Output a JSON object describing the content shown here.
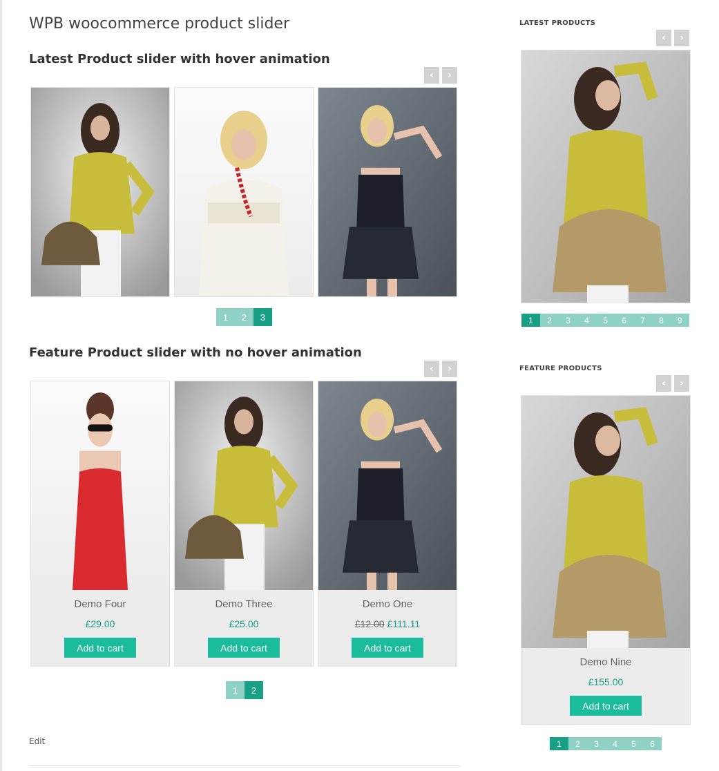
{
  "page": {
    "title": "WPB woocommerce product slider",
    "edit_label": "Edit"
  },
  "nav": {
    "prev": "‹",
    "next": "›"
  },
  "latest_slider": {
    "heading": "Latest Product slider with hover animation",
    "pages": [
      "1",
      "2",
      "3"
    ],
    "active_page": "3"
  },
  "feature_slider": {
    "heading": "Feature Product slider with no hover animation",
    "products": [
      {
        "name": "Demo Four",
        "price": "£29.00",
        "old_price": "",
        "button": "Add to cart"
      },
      {
        "name": "Demo Three",
        "price": "£25.00",
        "old_price": "",
        "button": "Add to cart"
      },
      {
        "name": "Demo One",
        "price": "£111.11",
        "old_price": "£12.00",
        "button": "Add to cart"
      }
    ],
    "pages": [
      "1",
      "2"
    ],
    "active_page": "2"
  },
  "sidebar": {
    "latest": {
      "title": "LATEST PRODUCTS",
      "pages": [
        "1",
        "2",
        "3",
        "4",
        "5",
        "6",
        "7",
        "8",
        "9"
      ],
      "active_page": "1"
    },
    "feature": {
      "title": "FEATURE PRODUCTS",
      "product": {
        "name": "Demo Nine",
        "price": "£155.00",
        "button": "Add to cart"
      },
      "pages": [
        "1",
        "2",
        "3",
        "4",
        "5",
        "6"
      ],
      "active_page": "1"
    }
  },
  "colors": {
    "accent": "#1abc9c",
    "price": "#1aa082",
    "pager_active": "#17a085",
    "pager_inactive": "#8fd1c4",
    "nav_button": "#d2d2d2"
  }
}
